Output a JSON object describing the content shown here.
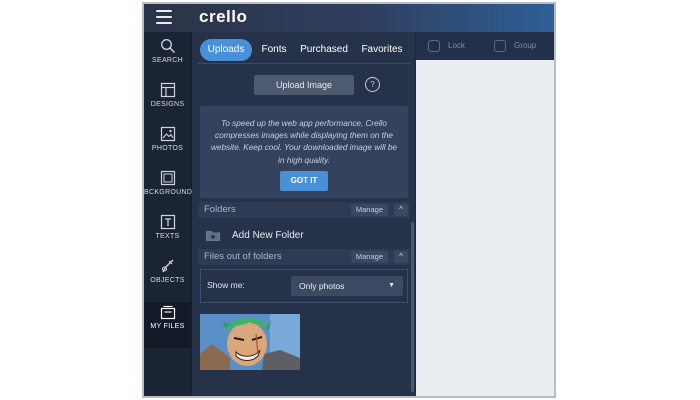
{
  "app": {
    "logo": "crello"
  },
  "rail": {
    "items": [
      {
        "label": "SEARCH",
        "icon": "search-icon"
      },
      {
        "label": "DESIGNS",
        "icon": "layout-icon"
      },
      {
        "label": "PHOTOS",
        "icon": "image-icon"
      },
      {
        "label": "BCKGROUND",
        "icon": "background-icon"
      },
      {
        "label": "TEXTS",
        "icon": "text-icon"
      },
      {
        "label": "OBJECTS",
        "icon": "objects-icon"
      },
      {
        "label": "MY FILES",
        "icon": "files-icon"
      }
    ]
  },
  "tabs": [
    {
      "label": "Uploads"
    },
    {
      "label": "Fonts"
    },
    {
      "label": "Purchased"
    },
    {
      "label": "Favorites"
    }
  ],
  "upload": {
    "button": "Upload Image",
    "help": "?"
  },
  "info": {
    "text": "To speed up the web app performance, Crello compresses images while displaying them on the website. Keep cool. Your downloaded image will be in high quality.",
    "button": "GOT IT"
  },
  "folders": {
    "title": "Folders",
    "manage": "Manage",
    "collapse": "^",
    "add_label": "Add New Folder"
  },
  "files": {
    "title": "Files out of folders",
    "manage": "Manage",
    "collapse": "^"
  },
  "filter": {
    "label": "Show me:",
    "selected": "Only photos"
  },
  "toolbar": {
    "lock": "Lock",
    "group": "Group"
  },
  "colors": {
    "accent": "#4a90d9",
    "panel": "#26324a",
    "rail": "#1b2434",
    "canvas": "#e9edf2"
  }
}
